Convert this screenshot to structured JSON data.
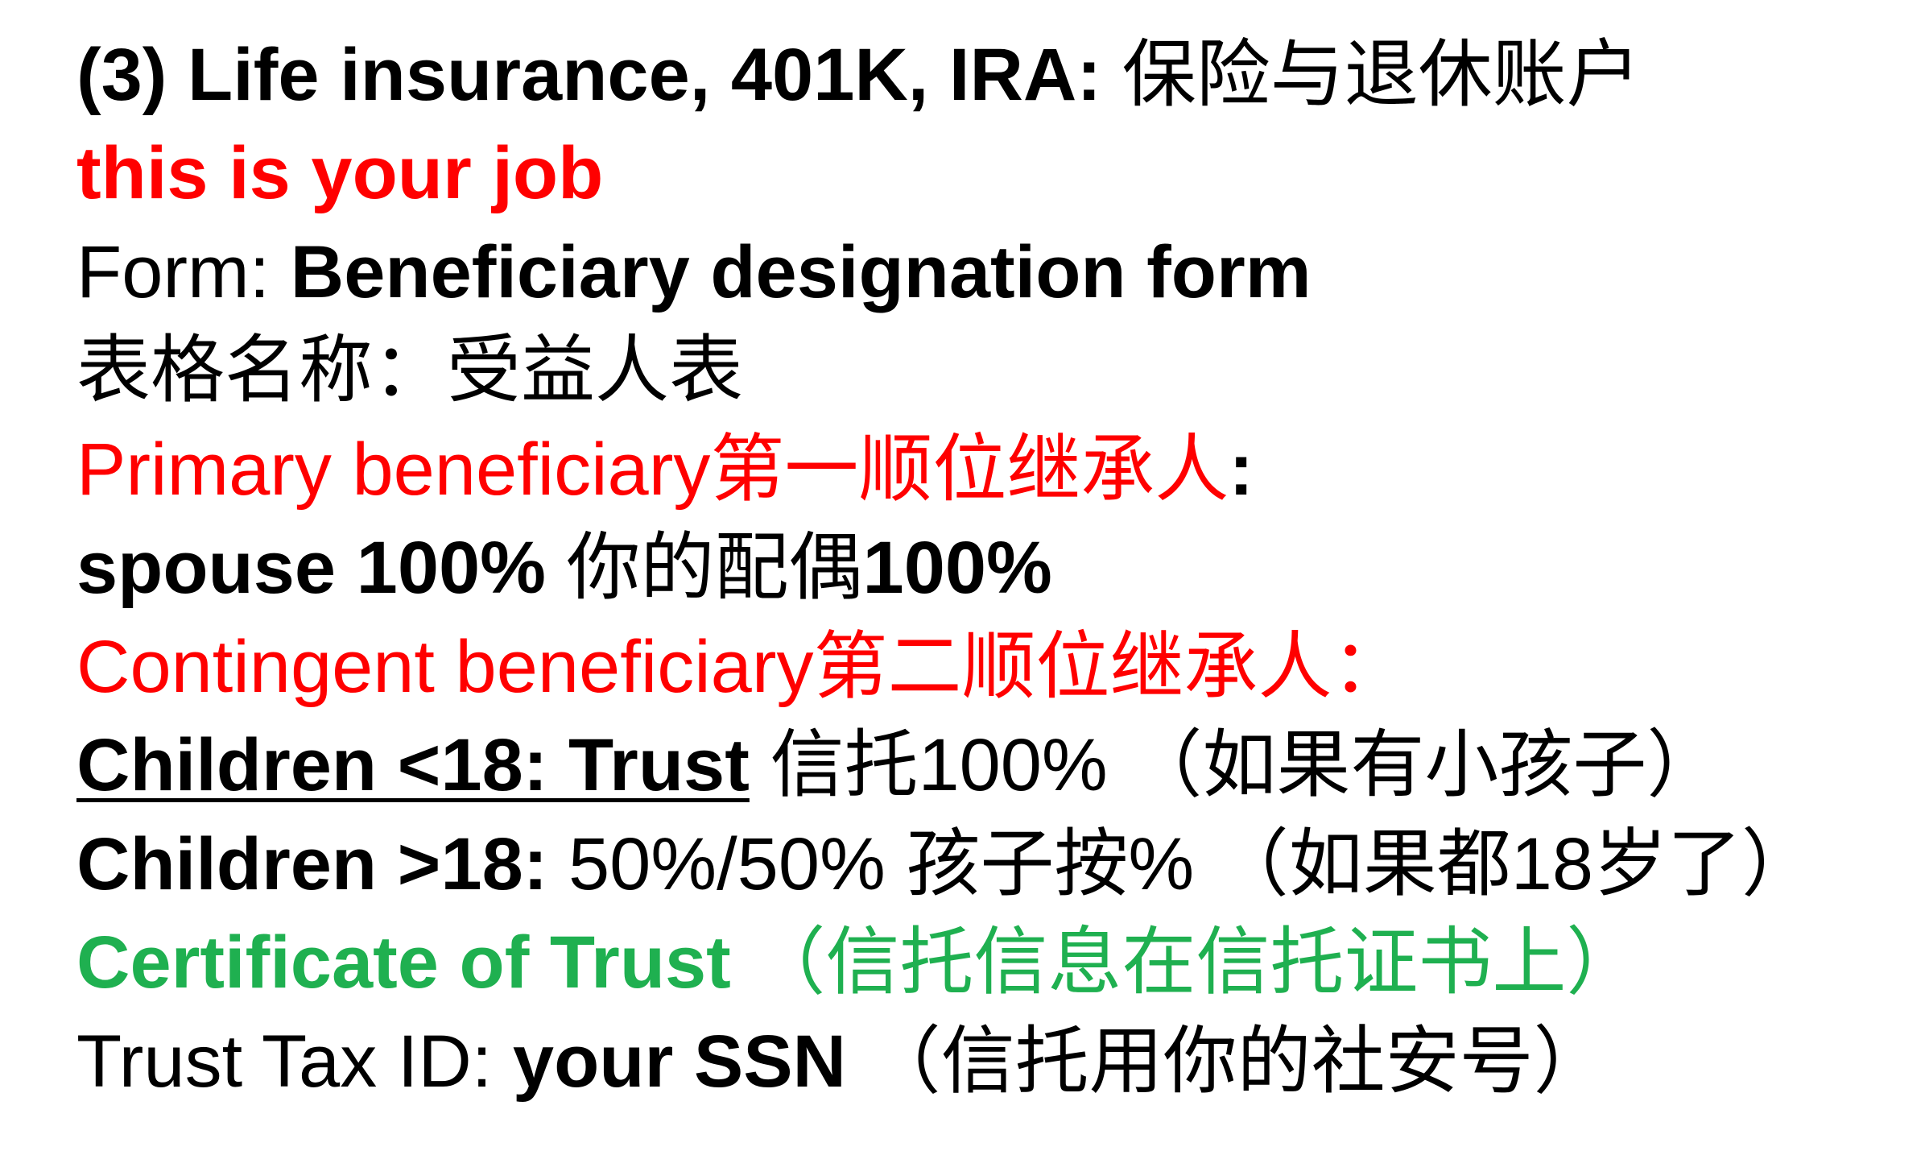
{
  "lines": {
    "l1_part1": "(3) Life insurance, 401K, IRA:",
    "l1_part2": "保险与退休账户",
    "l2": "this is your job",
    "l3_part1": "Form:",
    "l3_part2": "Beneficiary designation form",
    "l4": "表格名称：受益人表",
    "l5_part1": "Primary beneficiary第一顺位继承人",
    "l5_part2": ":",
    "l6_part1": "spouse 100%",
    "l6_part2": "你的配偶",
    "l6_part3": "100%",
    "l7": "Contingent beneficiary第二顺位继承人：",
    "l8_part1": "Children <18:  Trust",
    "l8_part2": "信托100%",
    "l8_part3": "（如果有小孩子）",
    "l9_part1": "Children >18:",
    "l9_part2": "50%/50% 孩子按% （如果都18岁了）",
    "l10_part1": "Certificate of Trust",
    "l10_part2": "（信托信息在信托证书上）",
    "l11_part1": "Trust Tax ID:",
    "l11_part2": "your SSN",
    "l11_part3": "（信托用你的社安号）"
  },
  "colors": {
    "text": "#000000",
    "red": "#ff0000",
    "green": "#1fb050",
    "background": "#ffffff"
  }
}
